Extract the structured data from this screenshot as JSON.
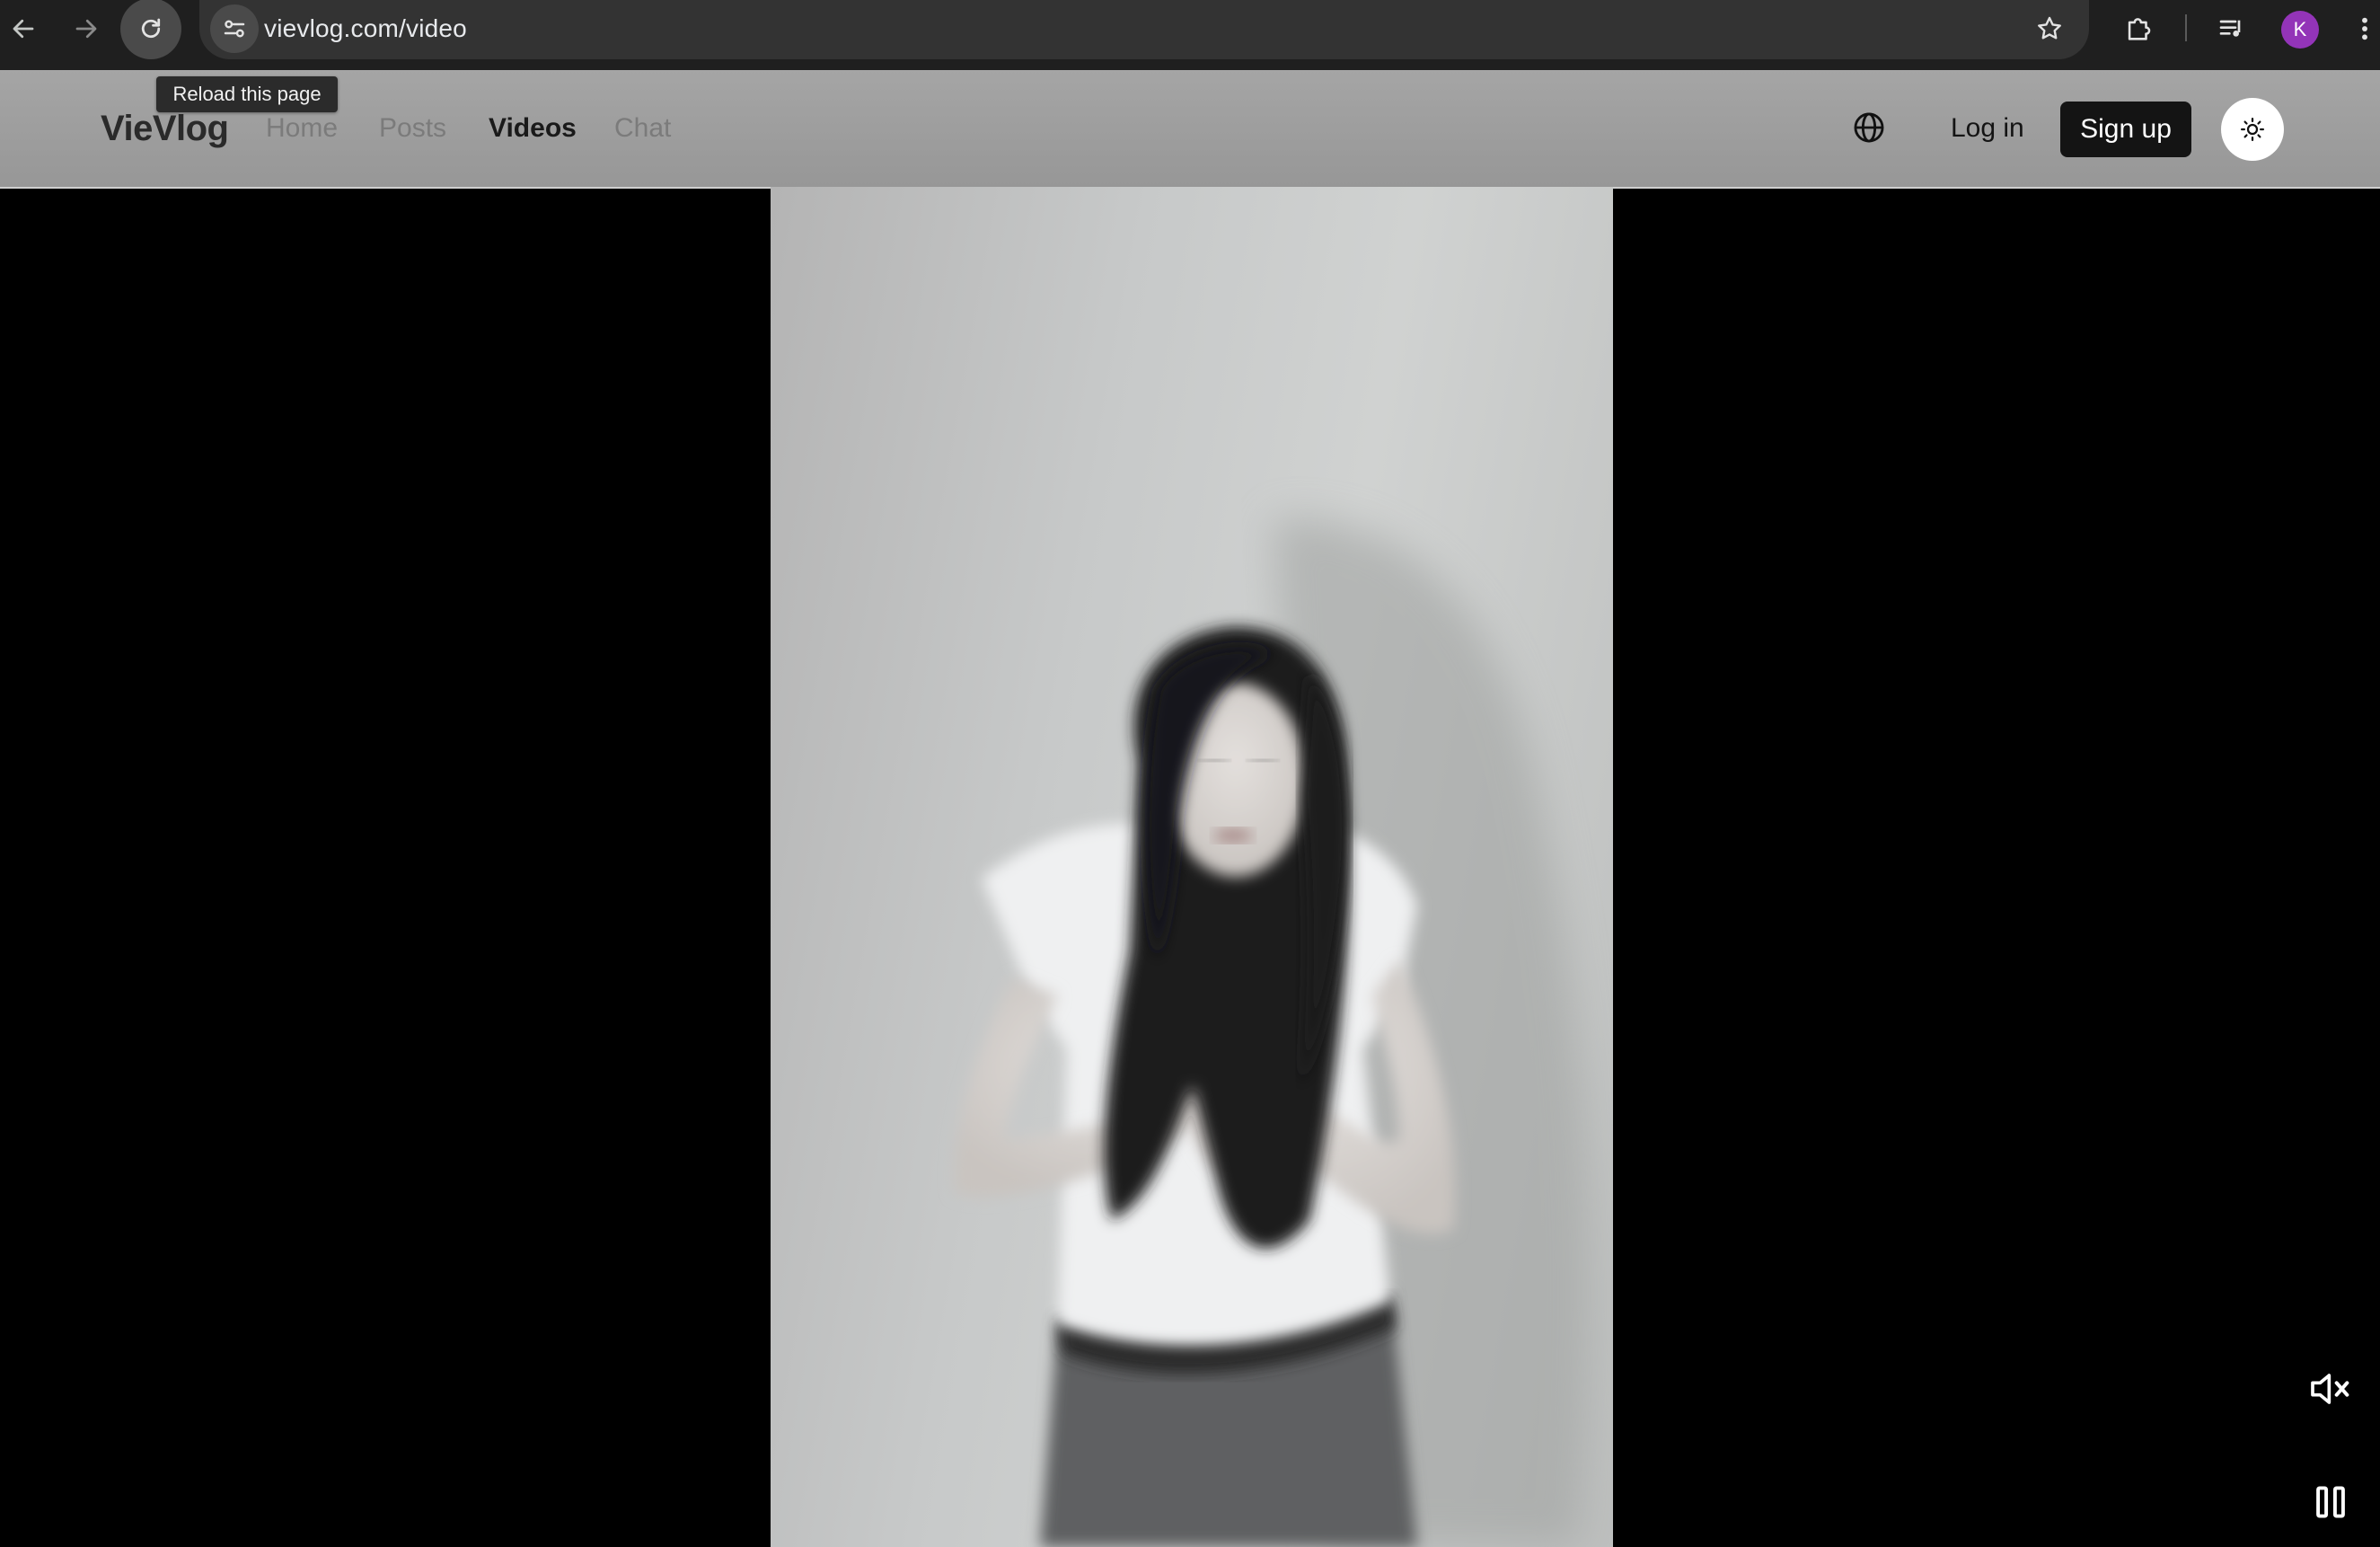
{
  "browser": {
    "url": "vievlog.com/video",
    "tooltip": "Reload this page",
    "profile_initial": "K",
    "profile_color": "#9334b8"
  },
  "header": {
    "logo": "VieVlog",
    "nav": {
      "home": "Home",
      "posts": "Posts",
      "videos": "Videos",
      "chat": "Chat"
    },
    "active_nav": "Videos",
    "login": "Log in",
    "signup": "Sign up"
  },
  "icons": {
    "back": "arrow-left-icon",
    "forward": "arrow-right-icon",
    "reload": "reload-icon",
    "site_settings": "tune-icon",
    "bookmark": "star-icon",
    "extensions": "puzzle-icon",
    "media": "media-queue-icon",
    "menu": "kebab-menu-icon",
    "language": "globe-icon",
    "theme": "sun-icon",
    "mute": "speaker-muted-icon",
    "pause": "pause-icon"
  },
  "player": {
    "muted": true,
    "playing": true
  }
}
